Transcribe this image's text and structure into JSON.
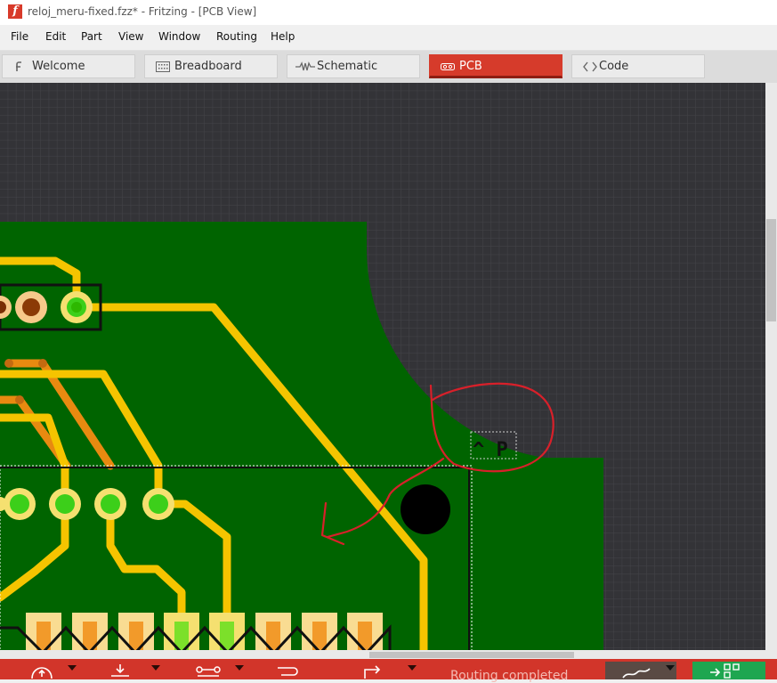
{
  "window": {
    "title": "reloj_meru-fixed.fzz* - Fritzing - [PCB View]",
    "app_icon": "fritzing-f-icon"
  },
  "menu": {
    "items": [
      "File",
      "Edit",
      "Part",
      "View",
      "Window",
      "Routing",
      "Help"
    ]
  },
  "tabs": [
    {
      "label": "Welcome",
      "icon": "fritzing-logo-icon",
      "active": false
    },
    {
      "label": "Breadboard",
      "icon": "breadboard-icon",
      "active": false
    },
    {
      "label": "Schematic",
      "icon": "resistor-icon",
      "active": false
    },
    {
      "label": "PCB",
      "icon": "pcb-icon",
      "active": true
    },
    {
      "label": "Code",
      "icon": "code-brackets-icon",
      "active": false
    }
  ],
  "canvas": {
    "silkscreen_label": "^ P",
    "colors": {
      "background": "#333337",
      "board": "#006400",
      "trace_top": "#f5c400",
      "trace_bottom": "#e88a10",
      "annotation": "#d8202a"
    }
  },
  "status": {
    "text": "Routing completed"
  },
  "colors": {
    "accent": "#d63b2b",
    "export_button": "#1ea650"
  }
}
